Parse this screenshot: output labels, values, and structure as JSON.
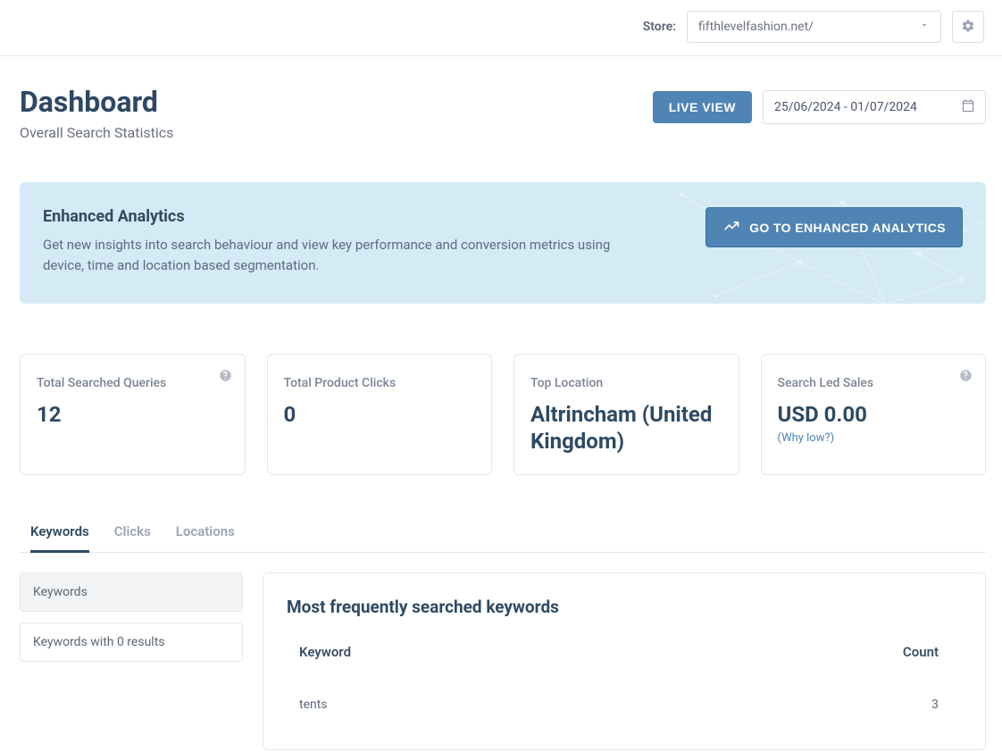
{
  "header": {
    "store_label": "Store:",
    "store_value": "fifthlevelfashion.net/"
  },
  "page": {
    "title": "Dashboard",
    "subtitle": "Overall Search Statistics",
    "live_view": "LIVE VIEW",
    "date_range": "25/06/2024 - 01/07/2024"
  },
  "banner": {
    "title": "Enhanced Analytics",
    "desc": "Get new insights into search behaviour and view key performance and conversion metrics using device, time and location based segmentation.",
    "button": "GO TO ENHANCED ANALYTICS"
  },
  "stats": {
    "queries_label": "Total Searched Queries",
    "queries_value": "12",
    "clicks_label": "Total Product Clicks",
    "clicks_value": "0",
    "location_label": "Top Location",
    "location_value": "Altrincham (United Kingdom)",
    "sales_label": "Search Led Sales",
    "sales_value": "USD 0.00",
    "sales_why": "(Why low?)"
  },
  "tabs": {
    "keywords": "Keywords",
    "clicks": "Clicks",
    "locations": "Locations"
  },
  "side": {
    "item1": "Keywords",
    "item2": "Keywords with 0 results"
  },
  "panel": {
    "title": "Most frequently searched keywords",
    "col1": "Keyword",
    "col2": "Count",
    "rows": [
      {
        "keyword": "tents",
        "count": "3"
      }
    ]
  }
}
